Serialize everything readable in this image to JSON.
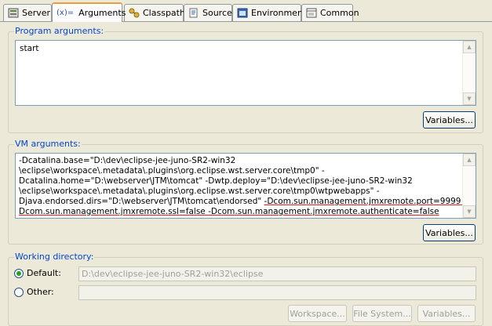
{
  "tabs": [
    {
      "label": "Server",
      "icon": "server-icon"
    },
    {
      "label": "Arguments",
      "icon": "arguments-icon",
      "icon_text": "(x)=",
      "active": true
    },
    {
      "label": "Classpath",
      "icon": "classpath-icon"
    },
    {
      "label": "Source",
      "icon": "source-icon"
    },
    {
      "label": "Environment",
      "icon": "environment-icon"
    },
    {
      "label": "Common",
      "icon": "common-icon"
    }
  ],
  "program_args": {
    "legend": "Program arguments:",
    "value": "start",
    "variables_label": "Variables..."
  },
  "vm_args": {
    "legend": "VM arguments:",
    "lines": [
      "-Dcatalina.base=\"D:\\dev\\eclipse-jee-juno-SR2-win32",
      "\\eclipse\\workspace\\.metadata\\.plugins\\org.eclipse.wst.server.core\\tmp0\" -",
      "Dcatalina.home=\"D:\\webserver\\JTM\\tomcat\" -Dwtp.deploy=\"D:\\dev\\eclipse-jee-juno-SR2-win32",
      "\\eclipse\\workspace\\.metadata\\.plugins\\org.eclipse.wst.server.core\\tmp0\\wtpwebapps\" -",
      "Djava.endorsed.dirs=\"D:\\webserver\\JTM\\tomcat\\endorsed\" ",
      "-Dcom.sun.management.jmxremote.port=9999 -",
      "Dcom.sun.management.jmxremote.ssl=false -Dcom.sun.management.jmxremote.authenticate=false"
    ],
    "variables_label": "Variables..."
  },
  "working_dir": {
    "legend": "Working directory:",
    "default_label": "Default:",
    "default_value": "D:\\dev\\eclipse-jee-juno-SR2-win32\\eclipse",
    "other_label": "Other:",
    "other_value": "",
    "workspace_label": "Workspace...",
    "filesystem_label": "File System...",
    "variables_label": "Variables..."
  },
  "colors": {
    "accent_tab": "#e6a03a",
    "legend": "#0046d5",
    "underline": "#e02020",
    "radio_selected": "#21a121"
  }
}
